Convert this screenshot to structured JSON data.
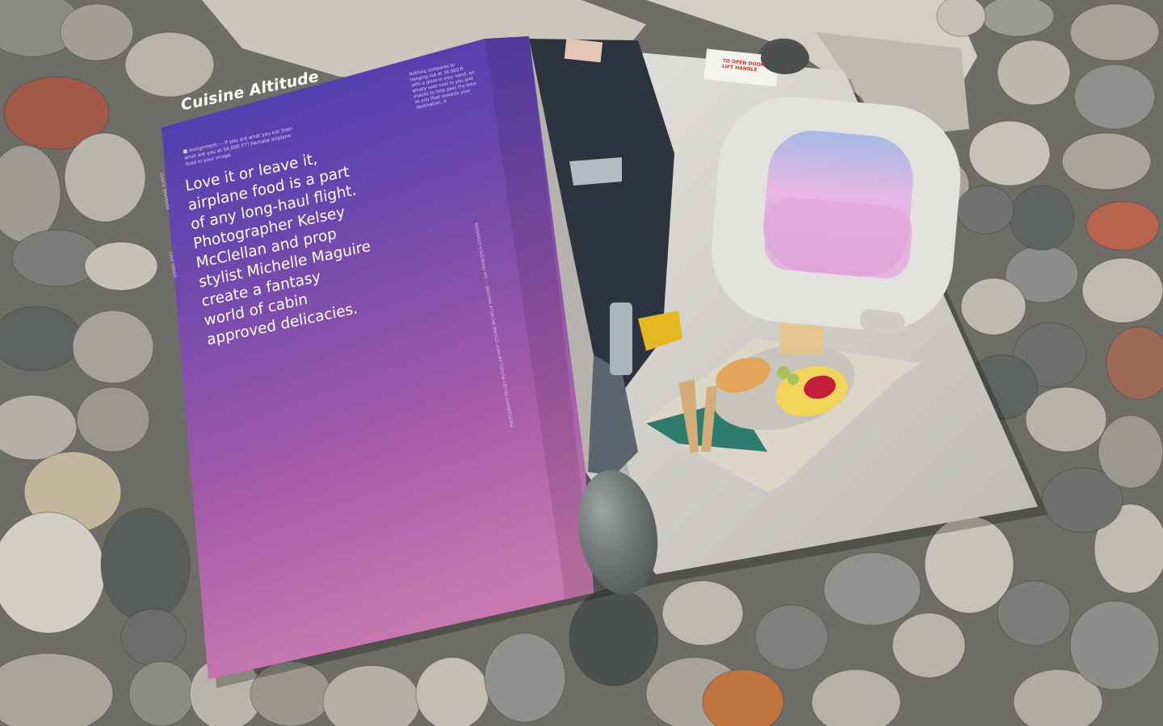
{
  "magazine": {
    "title": "Cuisine Altitude",
    "assignment": "■ Assignment — If you are what you eat then what are you at 34,000 FT? Remake airplane food in your image.",
    "headline_lines": [
      "Love it or leave it,",
      "airplane food is a part",
      "of any long-haul flight.",
      "Photographer Kelsey",
      "McClellan and prop",
      "stylist Michelle Maguire",
      "create a fantasy",
      "world of cabin",
      "approved delicacies."
    ],
    "side_note": "Nothing compares to hanging out at 34,000 ft with a glass in your hand, an empty seat next to you and snacks to help pass the time as you float towards your destination. ✈",
    "spine_section": "PERSONAL SUPPLY",
    "spine_issue": "SPRING 2023",
    "credit": "PHOTOGRAPHY KELSEY McCLELLAN  PROP STYLING MICHELLE MAGUIRE — See FRANCESCA CONSAGRA",
    "door_sign": "TO OPEN DOOR\nLIFT HANDLE"
  },
  "colors": {
    "page_gradient_top": "#4a3fb0",
    "page_gradient_mid": "#7a4fb0",
    "page_gradient_bottom": "#c46fb2",
    "rock_base": "#8a8780",
    "cabin_wall": "#d9d6d1",
    "seat": "#2f3440"
  }
}
